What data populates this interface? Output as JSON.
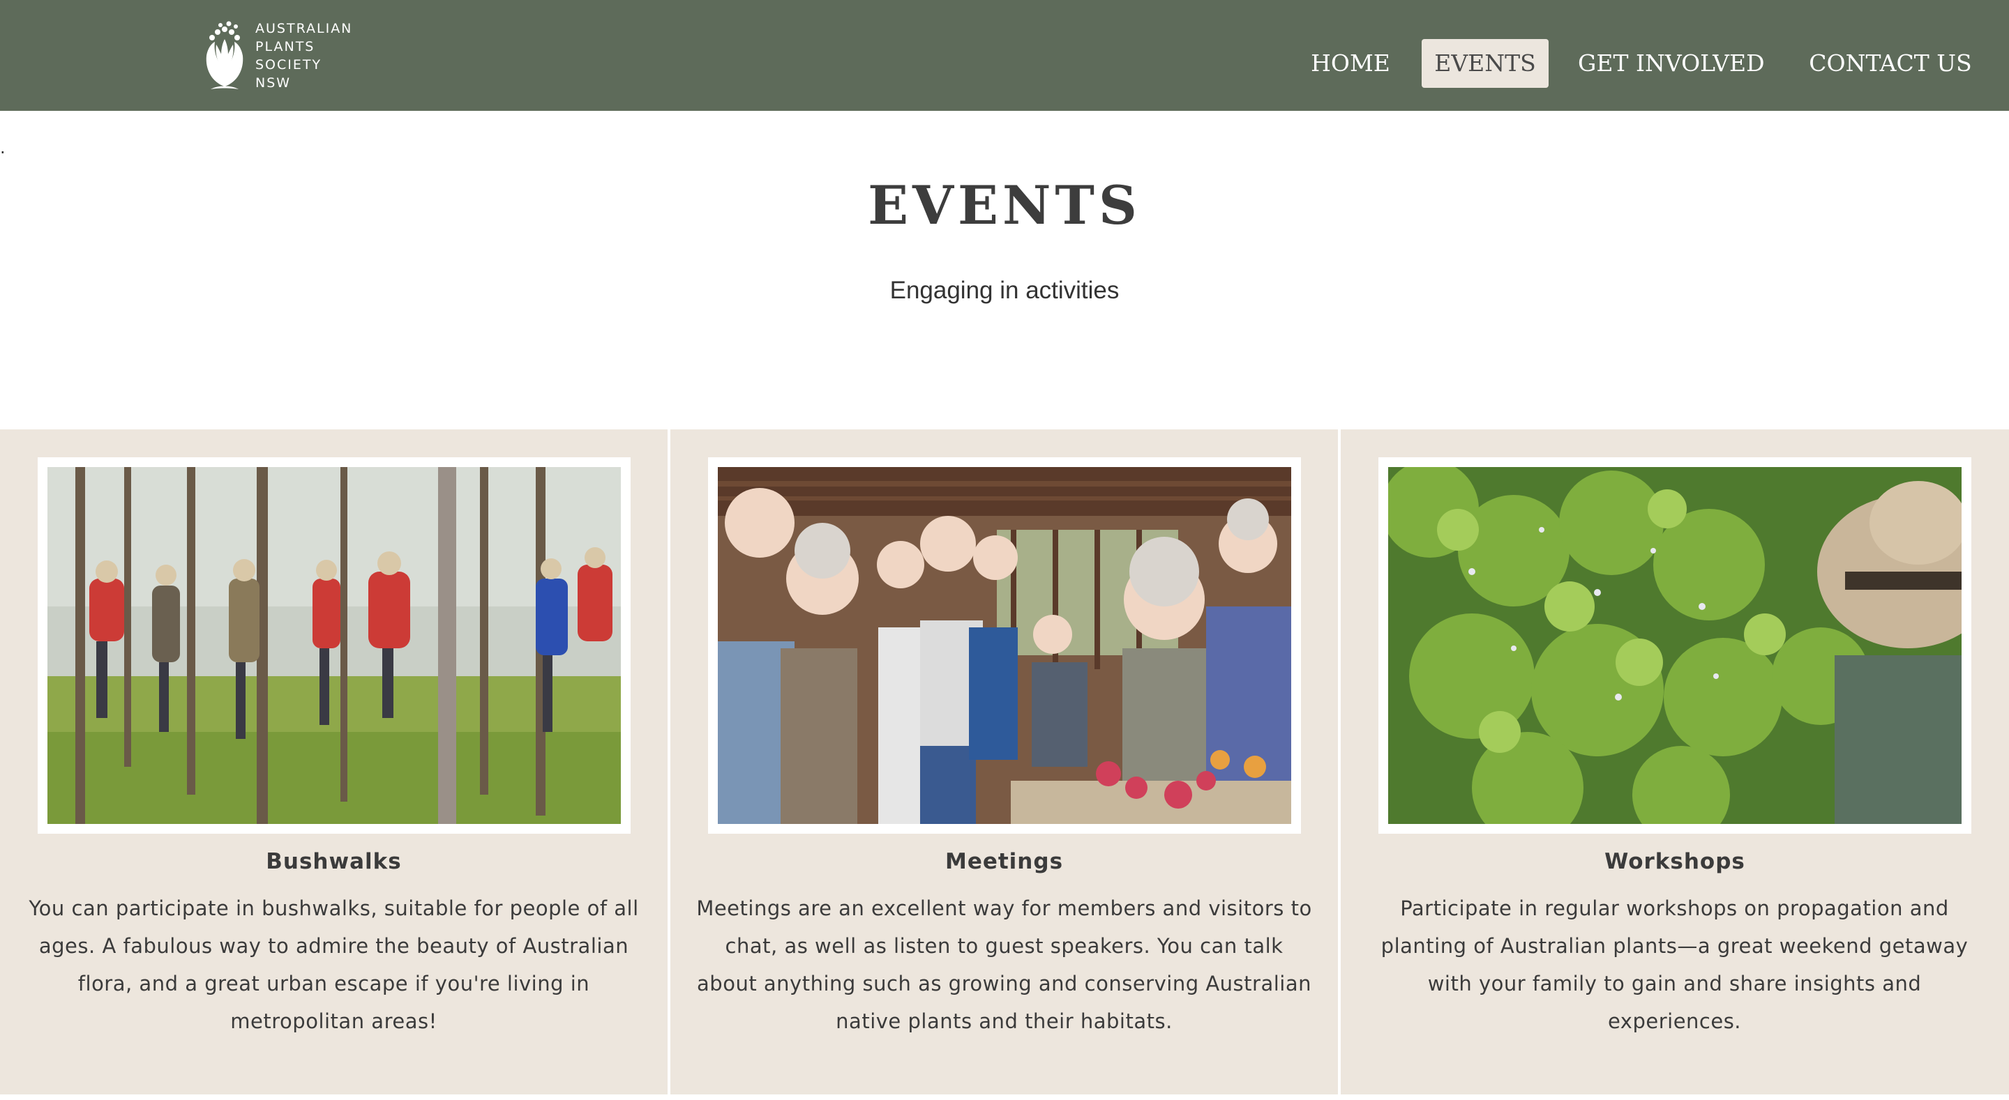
{
  "brand": {
    "logo_lines": [
      "AUSTRALIAN",
      "PLANTS",
      "SOCIETY",
      "NSW"
    ],
    "colors": {
      "header_bg": "#5e6b5a",
      "card_bg": "#ede6dd",
      "active_tab_bg": "#ece6de"
    }
  },
  "nav": {
    "items": [
      {
        "label": "HOME"
      },
      {
        "label": "EVENTS",
        "active": true
      },
      {
        "label": "GET INVOLVED"
      },
      {
        "label": "CONTACT US"
      }
    ]
  },
  "stray_mark": ".",
  "hero": {
    "title": "EVENTS",
    "subtitle": "Engaging in activities"
  },
  "cards": [
    {
      "title": "Bushwalks",
      "text": "You can participate in bushwalks, suitable for people of all ages. A fabulous way to admire the beauty of Australian flora, and a great urban escape if you're living in metropolitan areas!",
      "image": "bushwalk-group-photo"
    },
    {
      "title": "Meetings",
      "text": "Meetings are an excellent way for members and visitors to chat, as well as listen to guest speakers. You can talk about anything such as growing and conserving Australian native plants and their habitats.",
      "image": "meeting-group-photo"
    },
    {
      "title": "Workshops",
      "text": "Participate in regular workshops on propagation and planting of Australian plants—a great weekend getaway with your family to gain and share insights and experiences.",
      "image": "workshop-plants-photo"
    }
  ]
}
